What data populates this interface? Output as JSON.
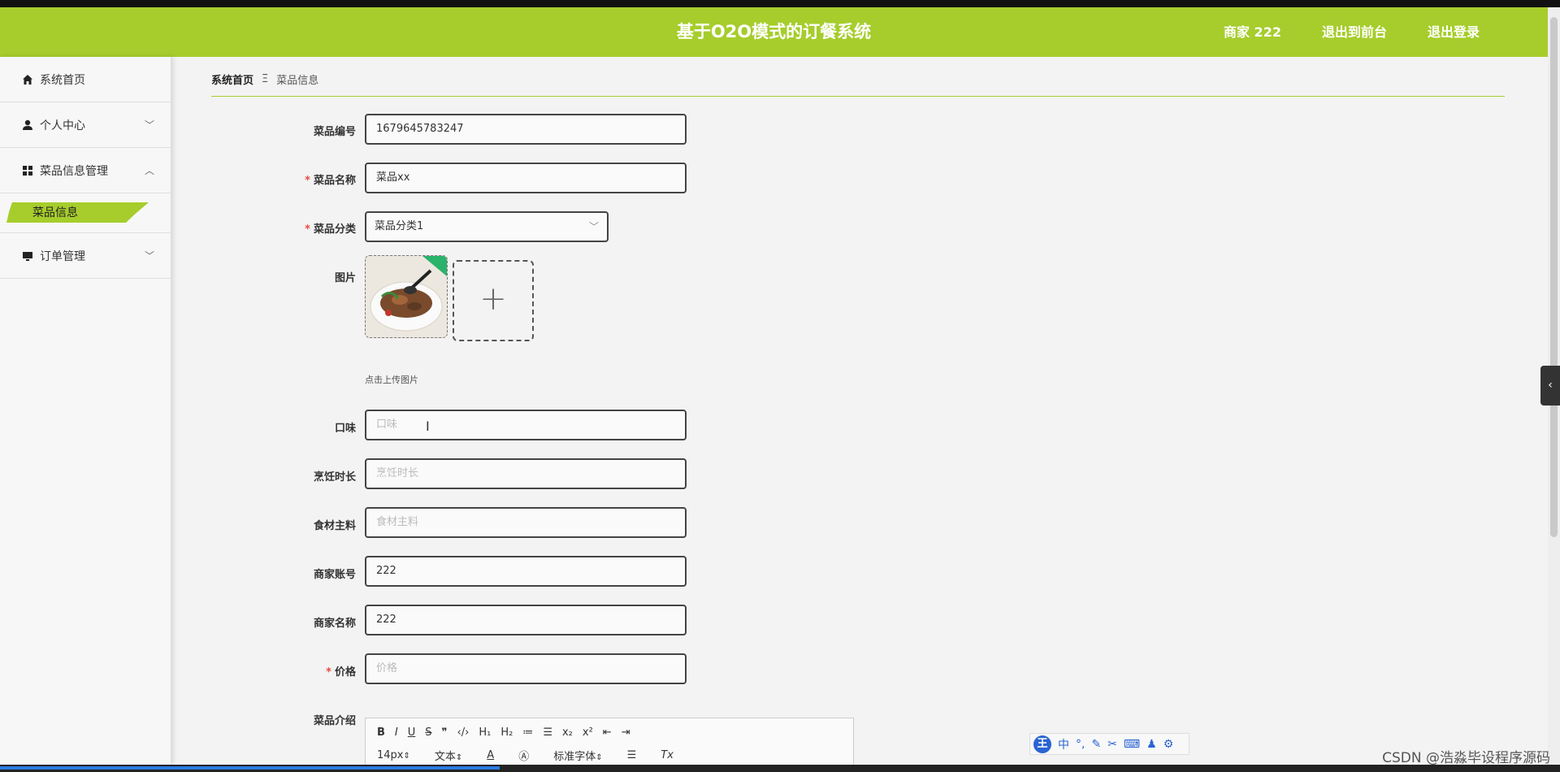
{
  "header": {
    "title": "基于O2O模式的订餐系统",
    "nav": [
      "商家 222",
      "退出到前台",
      "退出登录"
    ],
    "accent_color": "#a6cd2c"
  },
  "sidebar": {
    "items": [
      {
        "label": "系统首页",
        "icon": "home-icon"
      },
      {
        "label": "个人中心",
        "icon": "user-icon",
        "expandable": true
      },
      {
        "label": "菜品信息管理",
        "icon": "grid-icon",
        "expanded": true
      },
      {
        "label": "菜品信息",
        "submenu": true,
        "active": true
      },
      {
        "label": "订单管理",
        "icon": "monitor-icon",
        "expandable": true
      }
    ]
  },
  "breadcrumb": {
    "home": "系统首页",
    "separator": "Ξ",
    "current": "菜品信息"
  },
  "form": {
    "dish_no": {
      "label": "菜品编号",
      "value": "1679645783247"
    },
    "dish_name": {
      "label": "菜品名称",
      "value": "菜品xx",
      "required": true
    },
    "category": {
      "label": "菜品分类",
      "value": "菜品分类1",
      "required": true
    },
    "image": {
      "label": "图片",
      "tip": "点击上传图片"
    },
    "taste": {
      "label": "口味",
      "placeholder": "口味"
    },
    "cook_time": {
      "label": "烹饪时长",
      "placeholder": "烹饪时长"
    },
    "ingredients": {
      "label": "食材主料",
      "placeholder": "食材主料"
    },
    "merchant_account": {
      "label": "商家账号",
      "value": "222"
    },
    "merchant_name": {
      "label": "商家名称",
      "value": "222"
    },
    "price": {
      "label": "价格",
      "placeholder": "价格",
      "required": true
    },
    "intro": {
      "label": "菜品介绍"
    }
  },
  "editor": {
    "toolbar_row1": [
      "B",
      "I",
      "U",
      "S",
      "❞",
      "‹/›",
      "H₁",
      "H₂",
      "≔",
      "☰",
      "x₂",
      "x²",
      "⇤",
      "⇥"
    ],
    "font_size": "14px",
    "text_style": "文本",
    "font_family": "标准字体"
  },
  "ime_toolbar": {
    "logo": "王",
    "mode": "中"
  },
  "watermark": "CSDN @浩淼毕设程序源码"
}
